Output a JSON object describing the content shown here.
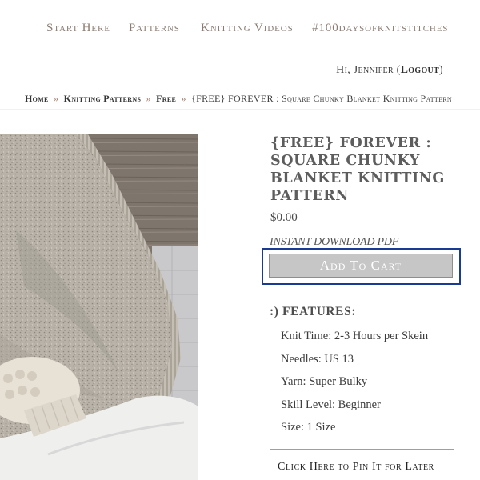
{
  "nav": {
    "items": [
      {
        "label": "Start Here"
      },
      {
        "label": "Patterns"
      },
      {
        "label": "Knitting Videos"
      },
      {
        "label": "#100daysofknitstitches"
      }
    ]
  },
  "account": {
    "greeting": "Hi, Jennifer (",
    "logout_label": "Logout",
    "closing": ")"
  },
  "breadcrumb": {
    "home": "Home",
    "separator": "»",
    "category": "Knitting Patterns",
    "subcategory": "Free",
    "current": "{FREE} FOREVER : Square Chunky Blanket Knitting Pattern"
  },
  "product": {
    "title": "{FREE} FOREVER : Square Chunky Blanket Knitting Pattern",
    "price": "$0.00",
    "download_note": "INSTANT DOWNLOAD PDF",
    "add_to_cart_label": "Add To Cart"
  },
  "features": {
    "heading": ":) FEATURES:",
    "items": [
      "Knit Time: 2-3 Hours per Skein",
      "Needles: US 13",
      "Yarn: Super Bulky",
      "Skill Level: Beginner",
      "Size: 1 Size"
    ]
  },
  "pin_link_label": "Click Here to Pin It for Later",
  "colors": {
    "nav_text": "#8a7b72",
    "focus_ring": "#1a3b94",
    "cart_button_bg": "#c6c6c6"
  }
}
